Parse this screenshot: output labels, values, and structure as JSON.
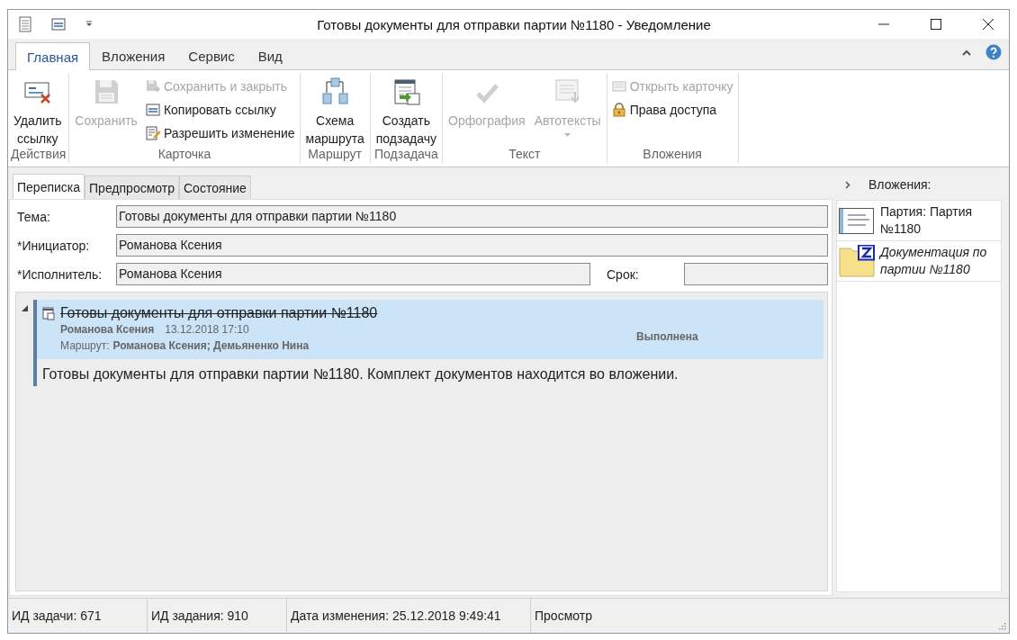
{
  "window": {
    "title": "Готовы документы для отправки партии №1180 - Уведомление"
  },
  "ribbon": {
    "tabs": [
      {
        "label": "Главная",
        "selected": true
      },
      {
        "label": "Вложения",
        "selected": false
      },
      {
        "label": "Сервис",
        "selected": false
      },
      {
        "label": "Вид",
        "selected": false
      }
    ],
    "groups": [
      {
        "label": "Действия",
        "items": [
          {
            "kind": "large",
            "label": "Удалить ссылку",
            "disabled": false
          }
        ]
      },
      {
        "label": "Карточка",
        "items": [
          {
            "kind": "large",
            "label": "Сохранить",
            "disabled": true
          },
          {
            "kind": "small",
            "label": "Сохранить и закрыть",
            "disabled": true
          },
          {
            "kind": "small",
            "label": "Копировать ссылку",
            "disabled": false
          },
          {
            "kind": "small",
            "label": "Разрешить изменение",
            "disabled": false
          }
        ]
      },
      {
        "label": "Маршрут",
        "items": [
          {
            "kind": "large",
            "label": "Схема маршрута",
            "disabled": false
          }
        ]
      },
      {
        "label": "Подзадача",
        "items": [
          {
            "kind": "large",
            "label": "Создать подзадачу",
            "disabled": false
          }
        ]
      },
      {
        "label": "Текст",
        "items": [
          {
            "kind": "large",
            "label": "Орфография",
            "disabled": true
          },
          {
            "kind": "dropdown",
            "label": "Автотексты",
            "disabled": true
          }
        ]
      },
      {
        "label": "Вложения",
        "items": [
          {
            "kind": "small",
            "label": "Открыть карточку",
            "disabled": true
          },
          {
            "kind": "small",
            "label": "Права доступа",
            "disabled": false
          }
        ]
      }
    ]
  },
  "content_tabs": [
    {
      "label": "Переписка",
      "selected": true
    },
    {
      "label": "Предпросмотр",
      "selected": false
    },
    {
      "label": "Состояние",
      "selected": false
    }
  ],
  "form": [
    {
      "fields": [
        {
          "label": "Тема:",
          "value": "Готовы документы для отправки партии №1180"
        }
      ]
    },
    {
      "fields": [
        {
          "label": "*Инициатор:",
          "value": "Романова Ксения"
        }
      ]
    },
    {
      "fields": [
        {
          "label": "*Исполнитель:",
          "value": "Романова Ксения"
        },
        {
          "label": "Срок:"
        }
      ]
    }
  ],
  "message": {
    "expanded": true,
    "subject": "Готовы документы для отправки партии №1180",
    "completed": true,
    "author": "Романова Ксения",
    "date": "13.12.2018 17:10",
    "route_label": "Маршрут:",
    "route": "Романова Ксения; Демьяненко Нина",
    "status": "Выполнена",
    "body": "Готовы документы для отправки партии №1180. Комплект документов находится во вложении."
  },
  "attachments": {
    "title": "Вложения:",
    "expanded": false,
    "items": [
      {
        "kind": "card",
        "label": "Партия: Партия №1180"
      },
      {
        "kind": "folder",
        "label": "Документация по партии №1180"
      }
    ]
  },
  "status_bar": [
    "ИД задачи: 671",
    "ИД задания: 910",
    "Дата изменения: 25.12.2018 9:49:41",
    "Просмотр"
  ]
}
